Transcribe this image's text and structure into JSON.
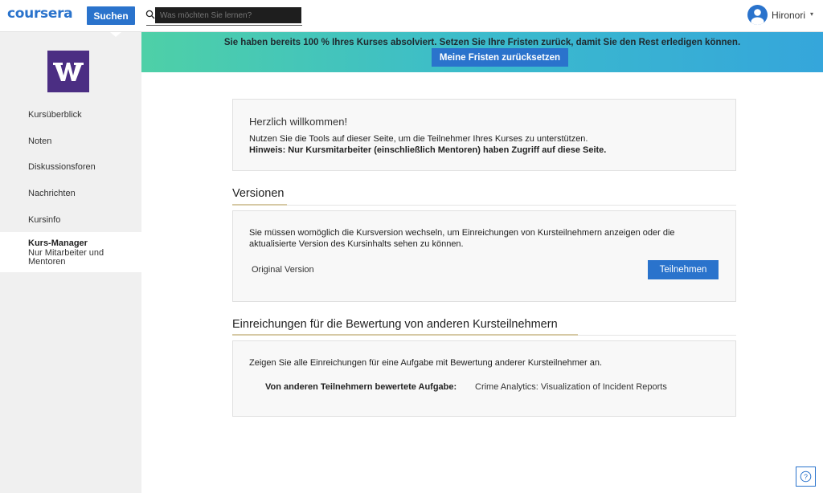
{
  "header": {
    "logo": "coursera",
    "search_button": "Suchen",
    "search_placeholder": "Was möchten Sie lernen?",
    "username": "Hironori",
    "user_caret": "▾"
  },
  "sidebar": {
    "items": [
      {
        "label": "Kursüberblick"
      },
      {
        "label": "Noten"
      },
      {
        "label": "Diskussionsforen"
      },
      {
        "label": "Nachrichten"
      },
      {
        "label": "Kursinfo"
      }
    ],
    "active": {
      "title": "Kurs-Manager",
      "subtitle": "Nur Mitarbeiter und Mentoren"
    }
  },
  "banner": {
    "text": "Sie haben bereits 100 % Ihres Kurses absolviert. Setzen Sie Ihre Fristen zurück, damit Sie den Rest erledigen können.",
    "button": "Meine Fristen zurücksetzen"
  },
  "welcome": {
    "title": "Herzlich willkommen!",
    "line1": "Nutzen Sie die Tools auf dieser Seite, um die Teilnehmer Ihres Kurses zu unterstützen.",
    "line2": "Hinweis: Nur Kursmitarbeiter (einschließlich Mentoren) haben Zugriff auf diese Seite."
  },
  "versions": {
    "heading": "Versionen",
    "text": "Sie müssen womöglich die Kursversion wechseln, um Einreichungen von Kursteilnehmern anzeigen oder die aktualisierte Version des Kursinhalts sehen zu können.",
    "label": "Original Version",
    "button": "Teilnehmen"
  },
  "submissions": {
    "heading": "Einreichungen für die Bewertung von anderen Kursteilnehmern",
    "text": "Zeigen Sie alle Einreichungen für eine Aufgabe mit Bewertung anderer Kursteilnehmer an.",
    "label": "Von anderen Teilnehmern bewertete Aufgabe:",
    "value": "Crime Analytics: Visualization of Incident Reports"
  },
  "help": {
    "icon": "help-icon"
  },
  "colors": {
    "brand": "#2a73cc",
    "uw_purple": "#4b2e83",
    "sidebar": "#f0f0f0"
  }
}
